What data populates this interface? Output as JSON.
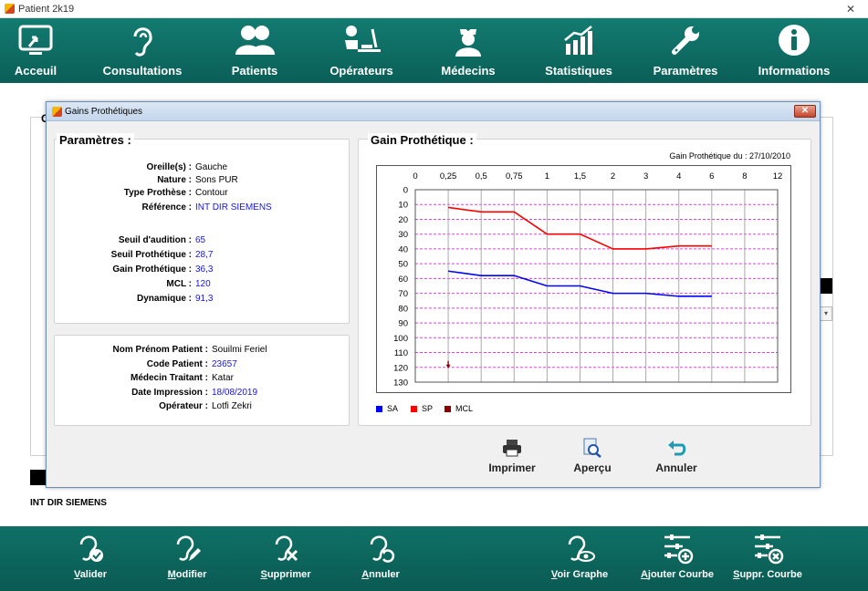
{
  "window": {
    "title": "Patient 2k19",
    "close_glyph": "✕"
  },
  "topnav": [
    {
      "label": "Acceuil",
      "icon": "home-screen-icon"
    },
    {
      "label": "Consultations",
      "icon": "ear-icon"
    },
    {
      "label": "Patients",
      "icon": "users-icon"
    },
    {
      "label": "Opérateurs",
      "icon": "desk-operator-icon"
    },
    {
      "label": "Médecins",
      "icon": "doctor-icon"
    },
    {
      "label": "Statistiques",
      "icon": "chart-icon"
    },
    {
      "label": "Paramètres",
      "icon": "wrench-icon"
    },
    {
      "label": "Informations",
      "icon": "info-icon"
    }
  ],
  "background": {
    "header_letter": "C",
    "reference": "INT DIR SIEMENS",
    "dropdown_glyph": "▾"
  },
  "dialog": {
    "title": "Gains Prothétiques",
    "close_glyph": "✕",
    "params": {
      "title": "Paramètres :",
      "rows": [
        {
          "key": "Oreille(s) :",
          "value": "Gauche",
          "blue": false
        },
        {
          "key": "Nature :",
          "value": "Sons PUR",
          "blue": false
        },
        {
          "key": "Type Prothèse :",
          "value": "Contour",
          "blue": false
        },
        {
          "key": "Référence :",
          "value": "INT DIR SIEMENS",
          "blue": true
        },
        {
          "key": "Seuil d'audition :",
          "value": "65",
          "blue": true
        },
        {
          "key": "Seuil Prothétique :",
          "value": "28,7",
          "blue": true
        },
        {
          "key": "Gain Prothétique :",
          "value": "36,3",
          "blue": true
        },
        {
          "key": "MCL :",
          "value": "120",
          "blue": true
        },
        {
          "key": "Dynamique :",
          "value": "91,3",
          "blue": true
        }
      ]
    },
    "patient": {
      "rows": [
        {
          "key": "Nom Prénom Patient :",
          "value": "Souilmi Feriel",
          "blue": false
        },
        {
          "key": "Code Patient :",
          "value": "23657",
          "blue": true
        },
        {
          "key": "Médecin Traitant :",
          "value": "Katar",
          "blue": false
        },
        {
          "key": "Date Impression :",
          "value": "18/08/2019",
          "blue": true
        },
        {
          "key": "Opérateur :",
          "value": "Lotfi Zekri",
          "blue": false
        }
      ]
    },
    "gain": {
      "title": "Gain Prothétique :",
      "subtitle": "Gain Prothétique du : 27/10/2010"
    },
    "actions": [
      {
        "label": "Imprimer",
        "icon": "printer-icon"
      },
      {
        "label": "Aperçu",
        "icon": "preview-icon"
      },
      {
        "label": "Annuler",
        "icon": "undo-icon"
      }
    ]
  },
  "chart_data": {
    "type": "line",
    "x_ticks": [
      "0",
      "0,25",
      "0,5",
      "0,75",
      "1",
      "1,5",
      "2",
      "3",
      "4",
      "6",
      "8",
      "12"
    ],
    "y_ticks": [
      "0",
      "10",
      "20",
      "30",
      "40",
      "50",
      "60",
      "70",
      "80",
      "90",
      "100",
      "110",
      "120",
      "130"
    ],
    "ylim": [
      0,
      130
    ],
    "y_inverted": true,
    "x_axis_position": "top",
    "grid": true,
    "legend_position": "bottom-left",
    "series": [
      {
        "name": "SA",
        "color": "#0000ff",
        "x": [
          "0,25",
          "0,5",
          "0,75",
          "1",
          "1,5",
          "2",
          "3",
          "4",
          "6"
        ],
        "values": [
          55,
          58,
          58,
          65,
          65,
          70,
          70,
          72,
          72
        ]
      },
      {
        "name": "SP",
        "color": "#ff0000",
        "x": [
          "0,25",
          "0,5",
          "0,75",
          "1",
          "1,5",
          "2",
          "3",
          "4",
          "6"
        ],
        "values": [
          12,
          15,
          15,
          30,
          30,
          40,
          40,
          38,
          38
        ]
      },
      {
        "name": "MCL",
        "color": "#8b0000",
        "x": [
          "0,25"
        ],
        "values": [
          120
        ]
      }
    ]
  },
  "bottombar": [
    {
      "label": "Valider",
      "icon": "ear-check-icon"
    },
    {
      "label": "Modifier",
      "icon": "ear-edit-icon"
    },
    {
      "label": "Supprimer",
      "icon": "ear-delete-icon"
    },
    {
      "label": "Annuler",
      "icon": "ear-undo-icon"
    },
    {
      "label": "Voir Graphe",
      "icon": "ear-view-icon"
    },
    {
      "label": "Ajouter Courbe",
      "icon": "sliders-add-icon"
    },
    {
      "label": "Suppr. Courbe",
      "icon": "sliders-remove-icon"
    }
  ]
}
